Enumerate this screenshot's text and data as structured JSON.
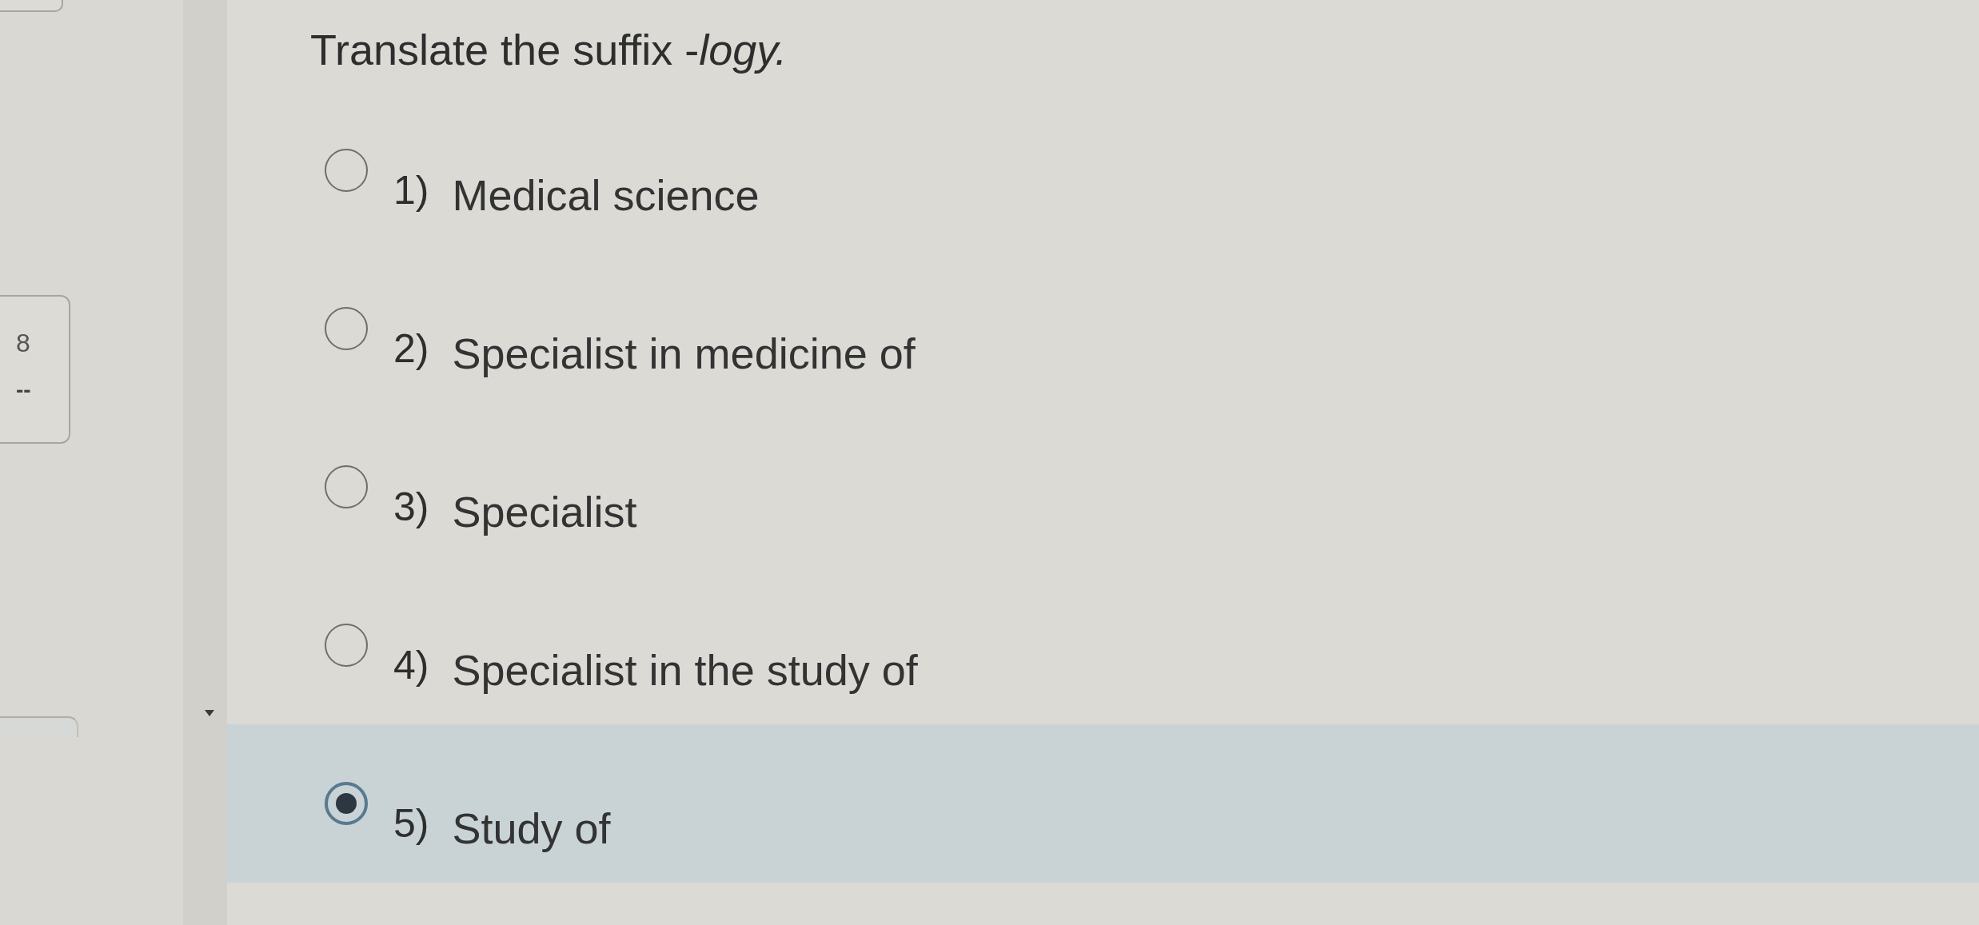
{
  "sidebar": {
    "question_card": {
      "number": "8",
      "status": "--"
    }
  },
  "question": {
    "prompt": "Translate the suffix -*logy.*"
  },
  "options": [
    {
      "number": "1)",
      "text": "Medical science",
      "selected": false
    },
    {
      "number": "2)",
      "text": "Specialist in medicine of",
      "selected": false
    },
    {
      "number": "3)",
      "text": "Specialist",
      "selected": false
    },
    {
      "number": "4)",
      "text": "Specialist in the study of",
      "selected": false
    },
    {
      "number": "5)",
      "text": "Study of",
      "selected": true
    }
  ]
}
